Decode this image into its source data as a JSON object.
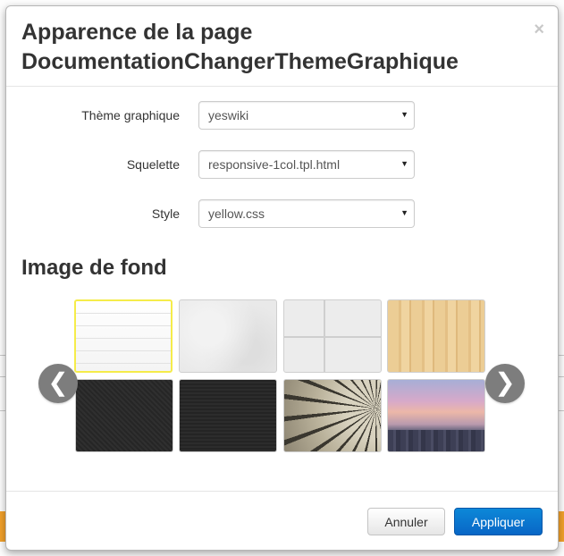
{
  "modal": {
    "title": "Apparence de la page DocumentationChangerThemeGraphique",
    "close_label": "×"
  },
  "form": {
    "theme": {
      "label": "Thème graphique",
      "value": "yeswiki"
    },
    "skeleton": {
      "label": "Squelette",
      "value": "responsive-1col.tpl.html"
    },
    "style": {
      "label": "Style",
      "value": "yellow.css"
    },
    "caret": "▼"
  },
  "background": {
    "title": "Image de fond",
    "prev_label": "❮",
    "next_label": "❯",
    "selected_index": 0,
    "thumbnails": [
      "white-wood-texture",
      "grey-paper-texture",
      "light-tiles-texture",
      "light-wood-texture",
      "dark-fabric-texture",
      "dark-texture",
      "ferris-wheel-photo",
      "city-sunset-photo"
    ]
  },
  "footer": {
    "cancel_label": "Annuler",
    "apply_label": "Appliquer"
  },
  "colors": {
    "primary": "#0866c6",
    "selected_border": "#f5ec4a",
    "background_accent": "#f2a12b"
  }
}
